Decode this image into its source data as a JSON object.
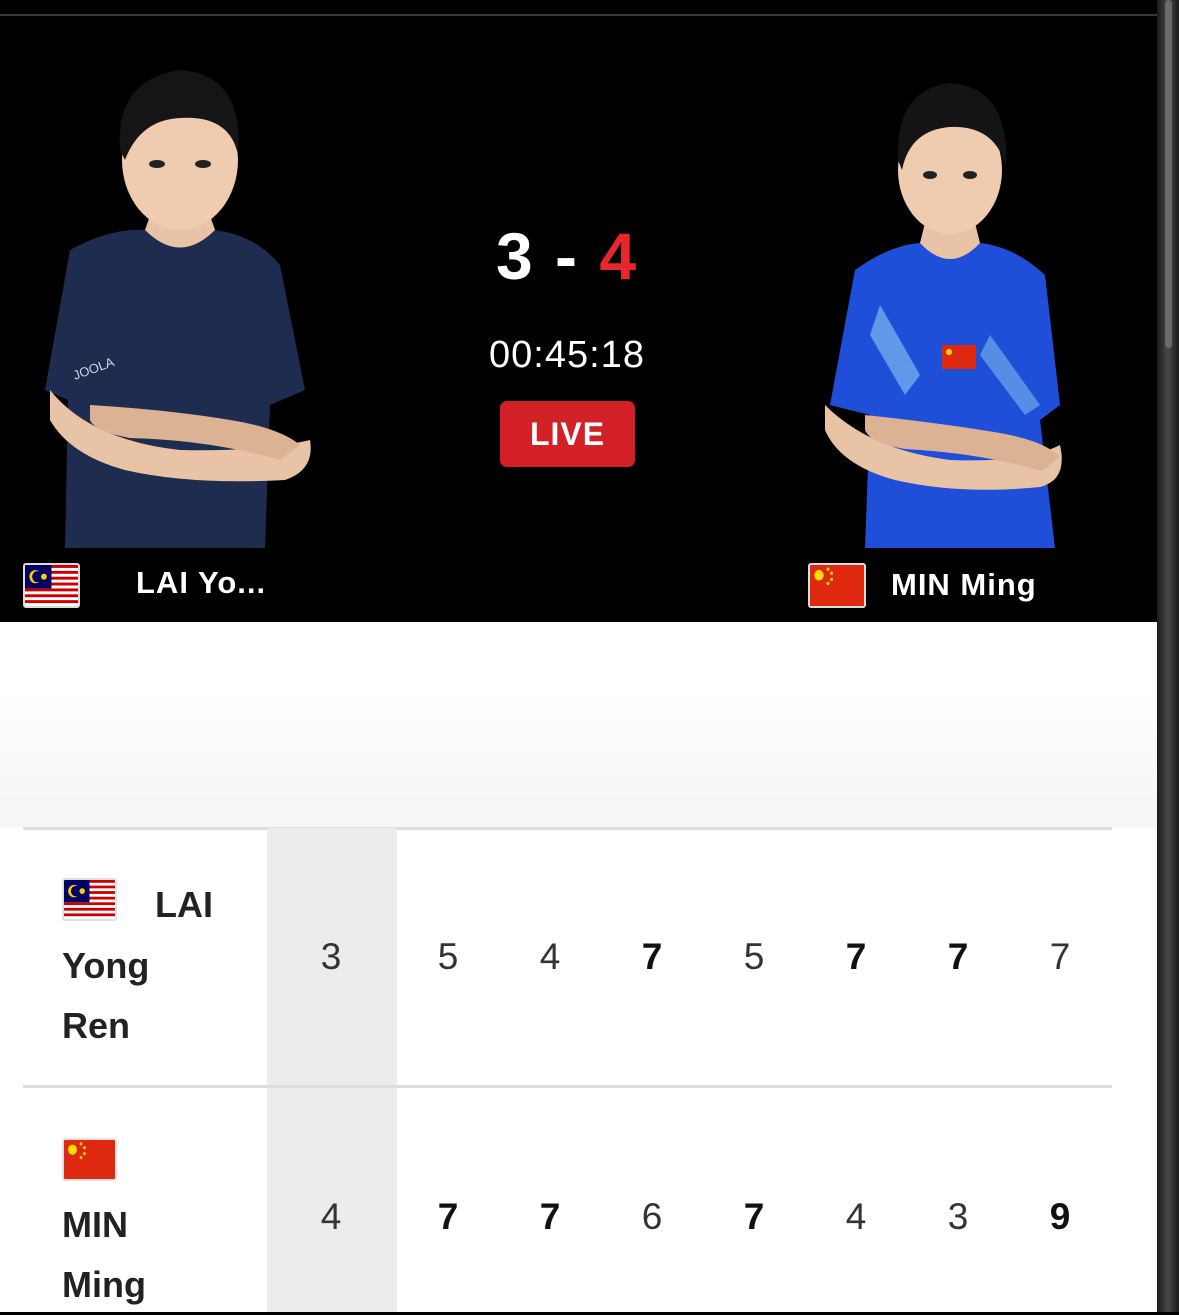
{
  "match": {
    "score_home": "3",
    "score_separator": "-",
    "score_away": "4",
    "timer": "00:45:18",
    "live_label": "LIVE"
  },
  "player1": {
    "short_name": "LAI Yo...",
    "name_line1": "LAI",
    "name_line2": "Yong",
    "name_line3": "Ren",
    "flag": "malaysia-flag-icon",
    "games": [
      "3",
      "5",
      "4",
      "7",
      "5",
      "7",
      "7",
      "7"
    ],
    "bold": [
      false,
      false,
      false,
      true,
      false,
      true,
      true,
      false
    ]
  },
  "player2": {
    "short_name": "MIN Ming",
    "name_line1": "MIN",
    "name_line2": "Ming",
    "flag": "china-flag-icon",
    "games": [
      "4",
      "7",
      "7",
      "6",
      "7",
      "4",
      "3",
      "9"
    ],
    "bold": [
      false,
      true,
      true,
      false,
      true,
      false,
      false,
      true
    ]
  },
  "colors": {
    "live_red": "#d31f26",
    "score_red": "#e8262c",
    "highlight_column": "#ececee"
  }
}
